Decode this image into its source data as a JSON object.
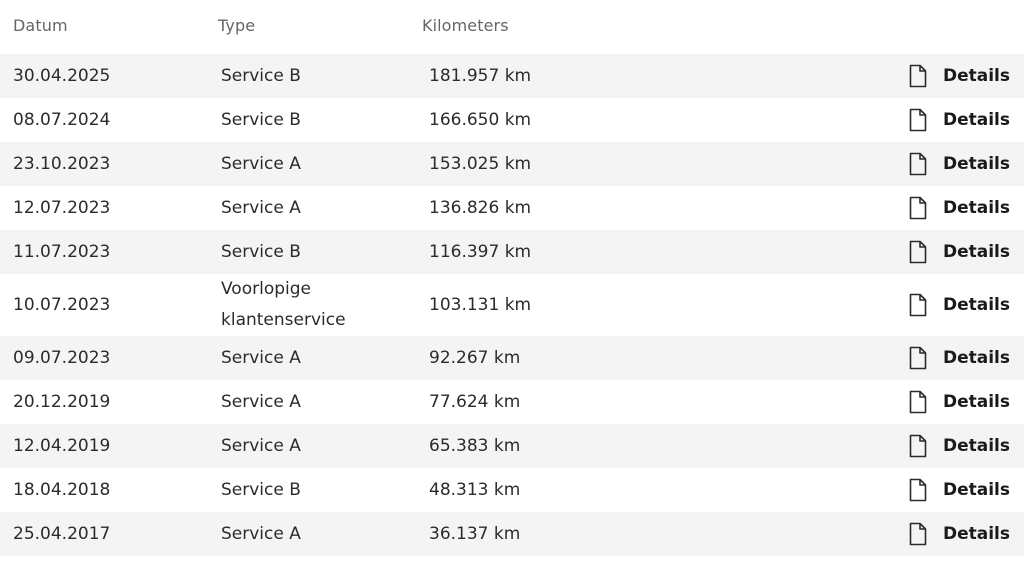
{
  "headers": {
    "date": "Datum",
    "type": "Type",
    "km": "Kilometers"
  },
  "details_label": "Details",
  "rows": [
    {
      "date": "30.04.2025",
      "type": "Service B",
      "km": "181.957 km"
    },
    {
      "date": "08.07.2024",
      "type": "Service B",
      "km": "166.650 km"
    },
    {
      "date": "23.10.2023",
      "type": "Service A",
      "km": "153.025 km"
    },
    {
      "date": "12.07.2023",
      "type": "Service A",
      "km": "136.826 km"
    },
    {
      "date": "11.07.2023",
      "type": "Service B",
      "km": "116.397 km"
    },
    {
      "date": "10.07.2023",
      "type": "Voorlopige klantenservice",
      "km": "103.131 km"
    },
    {
      "date": "09.07.2023",
      "type": "Service A",
      "km": "92.267 km"
    },
    {
      "date": "20.12.2019",
      "type": "Service A",
      "km": "77.624 km"
    },
    {
      "date": "12.04.2019",
      "type": "Service A",
      "km": "65.383 km"
    },
    {
      "date": "18.04.2018",
      "type": "Service B",
      "km": "48.313 km"
    },
    {
      "date": "25.04.2017",
      "type": "Service A",
      "km": "36.137 km"
    }
  ],
  "icons": {
    "details": "document-icon"
  }
}
